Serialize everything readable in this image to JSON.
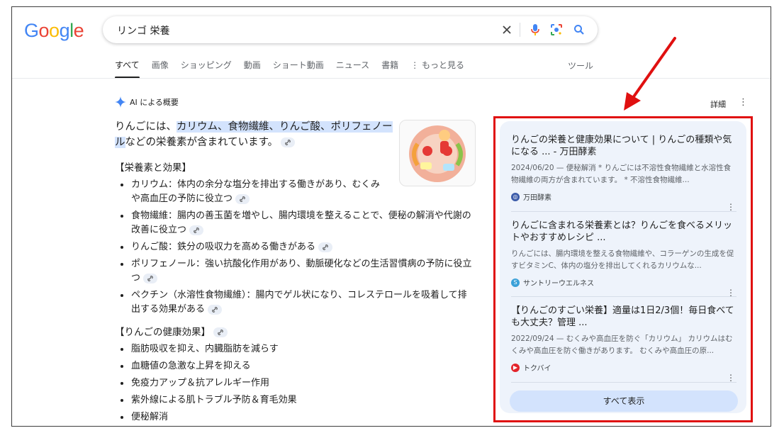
{
  "header": {
    "logo_text": "Google",
    "search_query": "リンゴ 栄養",
    "icons": [
      "close-icon",
      "mic-icon",
      "lens-icon",
      "search-icon"
    ]
  },
  "tabs": [
    {
      "label": "すべて",
      "active": true
    },
    {
      "label": "画像"
    },
    {
      "label": "ショッピング"
    },
    {
      "label": "動画"
    },
    {
      "label": "ショート動画"
    },
    {
      "label": "ニュース"
    },
    {
      "label": "書籍"
    },
    {
      "label": "もっと見る"
    }
  ],
  "tools_label": "ツール",
  "ai_overview": {
    "title": "AI による概要",
    "detail_label": "詳細",
    "intro_pre": "りんごには、",
    "intro_hl": "カリウム、食物繊維、りんご酸、ポリフェノール",
    "intro_post": "などの栄養素が含まれています。",
    "section1": "【栄養素と効果】",
    "bullets1": [
      "カリウム：体内の余分な塩分を排出する働きがあり、むくみや高血圧の予防に役立つ",
      "食物繊維：腸内の善玉菌を増やし、腸内環境を整えることで、便秘の解消や代謝の改善に役立つ",
      "りんご酸：鉄分の吸収力を高める働きがある",
      "ポリフェノール：強い抗酸化作用があり、動脈硬化などの生活習慣病の予防に役立つ",
      "ペクチン（水溶性食物繊維）：腸内でゲル状になり、コレステロールを吸着して排出する効果がある"
    ],
    "section2": "【りんごの健康効果】",
    "bullets2": [
      "脂肪吸収を抑え、内臓脂肪を減らす",
      "血糖値の急激な上昇を抑える",
      "免疫力アップ＆抗アレルギー作用",
      "紫外線による肌トラブル予防＆育毛効果",
      "便秘解消"
    ]
  },
  "sources": {
    "cards": [
      {
        "title": "りんごの栄養と健康効果について | りんごの種類や気になる ... - 万田酵素",
        "snippet": "2024/06/20 — 便秘解消 * りんごには不溶性食物繊維と水溶性食物繊維の両方が含まれています。 * 不溶性食物繊維...",
        "source": "万田酵素",
        "fav_color": "#3b5ba9",
        "fav_icon": "globe-icon"
      },
      {
        "title": "りんごに含まれる栄養素とは？りんごを食べるメリットやおすすめレシピ ...",
        "snippet": "りんごには、腸内環境を整える食物繊維や、コラーゲンの生成を促すビタミンC、体内の塩分を排出してくれるカリウムな...",
        "source": "サントリーウエルネス",
        "fav_color": "#3aa0d8",
        "fav_icon": "s-icon"
      },
      {
        "title": "【りんごのすごい栄養】適量は1日2/3個！毎日食べても大丈夫？管理 ...",
        "snippet": "2022/09/24 — むくみや高血圧を防ぐ「カリウム」 カリウムはむくみや高血圧を防ぐ働きがあります。 むくみや高血圧の原...",
        "source": "トクバイ",
        "fav_color": "#e3242b",
        "fav_icon": "play-icon"
      }
    ],
    "show_all_label": "すべて表示"
  },
  "colors": {
    "highlight": "#d3e3fd",
    "panel": "#eef3fb",
    "annotation_red": "#e01010"
  }
}
